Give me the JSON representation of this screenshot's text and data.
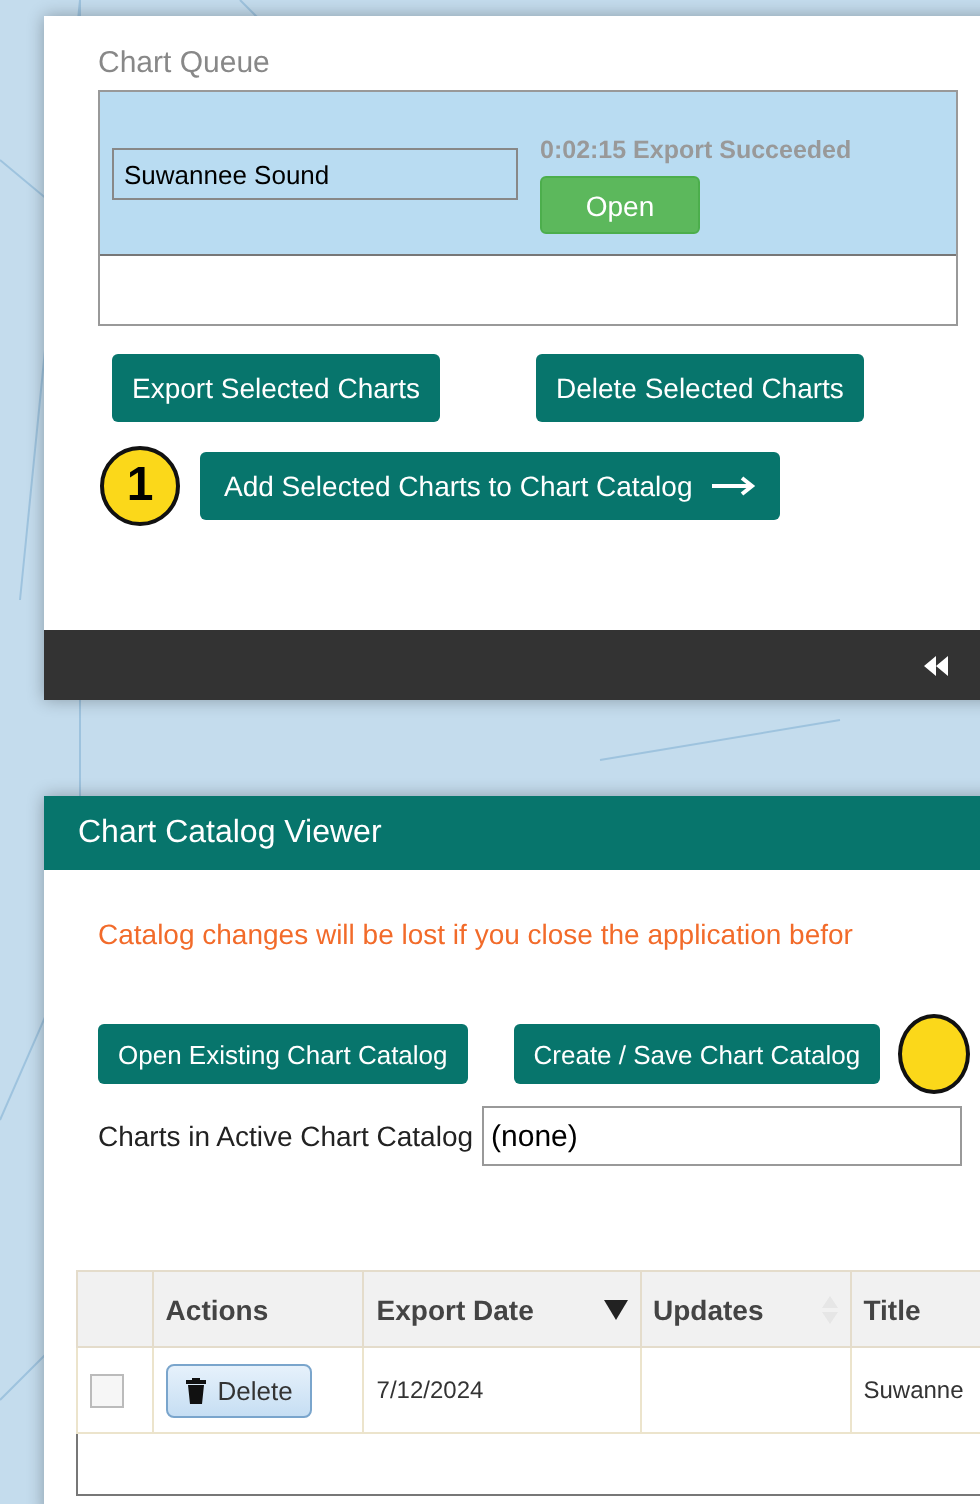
{
  "chart_queue": {
    "title": "Chart Queue",
    "items": [
      {
        "name": "Suwannee Sound",
        "status": "0:02:15 Export Succeeded",
        "action": "Open",
        "selected": true
      }
    ],
    "buttons": [
      "Export Selected Charts",
      "Delete Selected Charts"
    ],
    "callout": "1",
    "add_button": "Add Selected Charts to Chart Catalog"
  },
  "catalog_viewer": {
    "title": "Chart Catalog Viewer",
    "warning": "Catalog changes will be lost if you close the application befor",
    "buttons": [
      "Open Existing Chart Catalog",
      "Create / Save Chart Catalog"
    ],
    "active_label": "Charts in Active Chart Catalog",
    "active_value": "(none)",
    "table": {
      "columns": [
        {
          "label": "Actions",
          "kind": "plain"
        },
        {
          "label": "Export Date",
          "kind": "sorted"
        },
        {
          "label": "Updates",
          "kind": "sortable"
        },
        {
          "label": "Title",
          "kind": "plain"
        }
      ],
      "rows": [
        {
          "checked": false,
          "action": "Delete",
          "export_date": "7/12/2024",
          "title": "Suwanne"
        }
      ]
    }
  }
}
